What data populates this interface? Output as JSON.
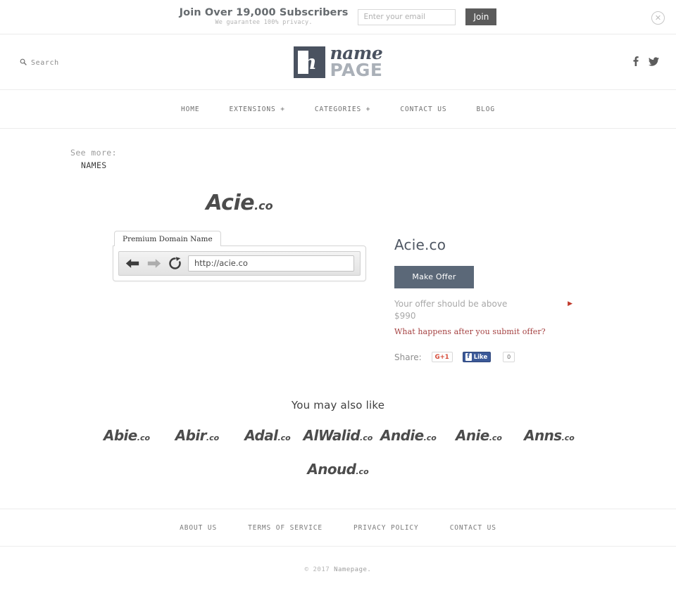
{
  "subscribe": {
    "title": "Join Over 19,000 Subscribers",
    "subtitle": "We guarantee 100% privacy.",
    "email_placeholder": "Enter your email",
    "email_value": "",
    "join_label": "Join",
    "close_icon": "close-circle-icon"
  },
  "header": {
    "search_label": "Search",
    "search_icon": "search-icon",
    "logo_mark": "n",
    "logo_name": "name",
    "logo_page": "PAGE",
    "social": [
      {
        "name": "facebook-icon",
        "glyph": "f"
      },
      {
        "name": "twitter-icon",
        "glyph": "t"
      }
    ]
  },
  "nav": {
    "items": [
      {
        "label": "HOME"
      },
      {
        "label": "EXTENSIONS +"
      },
      {
        "label": "CATEGORIES +"
      },
      {
        "label": "CONTACT US"
      },
      {
        "label": "BLOG"
      }
    ]
  },
  "breadcrumb": {
    "label": "See more:",
    "value": "NAMES"
  },
  "domain": {
    "name": "Acie",
    "tld": ".co",
    "full": "Acie.co"
  },
  "browser": {
    "tab_label": "Premium Domain Name",
    "back_icon": "back-arrow-icon",
    "forward_icon": "forward-arrow-icon",
    "reload_icon": "reload-icon",
    "url": "http://acie.co"
  },
  "offer": {
    "title": "Acie.co",
    "button_label": "Make Offer",
    "hint_line1": "Your offer should be above",
    "hint_line2": "$990",
    "minimum_price": "$990",
    "link_label": "What happens after you submit offer?",
    "marker_icon": "red-arrow-marker-icon",
    "share_label": "Share:",
    "gplus_label": "G+1",
    "fb_like_label": "Like",
    "fb_count": "0"
  },
  "also_like": {
    "title": "You may also like",
    "row1": [
      {
        "name": "Abie",
        "tld": ".co"
      },
      {
        "name": "Abir",
        "tld": ".co"
      },
      {
        "name": "Adal",
        "tld": ".co"
      },
      {
        "name": "Al",
        "name_dim": "Walid",
        "tld": ".co"
      },
      {
        "name": "Andie",
        "tld": ".co"
      },
      {
        "name": "Anie",
        "tld": ".co"
      },
      {
        "name": "Anns",
        "tld": ".co"
      }
    ],
    "row2": [
      {
        "name": "Anoud",
        "tld": ".co"
      }
    ]
  },
  "footer": {
    "links": [
      {
        "label": "ABOUT US"
      },
      {
        "label": "TERMS OF SERVICE"
      },
      {
        "label": "PRIVACY POLICY"
      },
      {
        "label": "CONTACT US"
      }
    ],
    "copyright_year": "© 2017",
    "copyright_name": "Namepage."
  },
  "colors": {
    "logo_navy": "#4a5260",
    "button_slate": "#5b6878",
    "join_gray": "#5b5b5b",
    "link_red": "#a44040",
    "facebook_blue": "#3b5998",
    "gplus_red": "#d64937"
  }
}
